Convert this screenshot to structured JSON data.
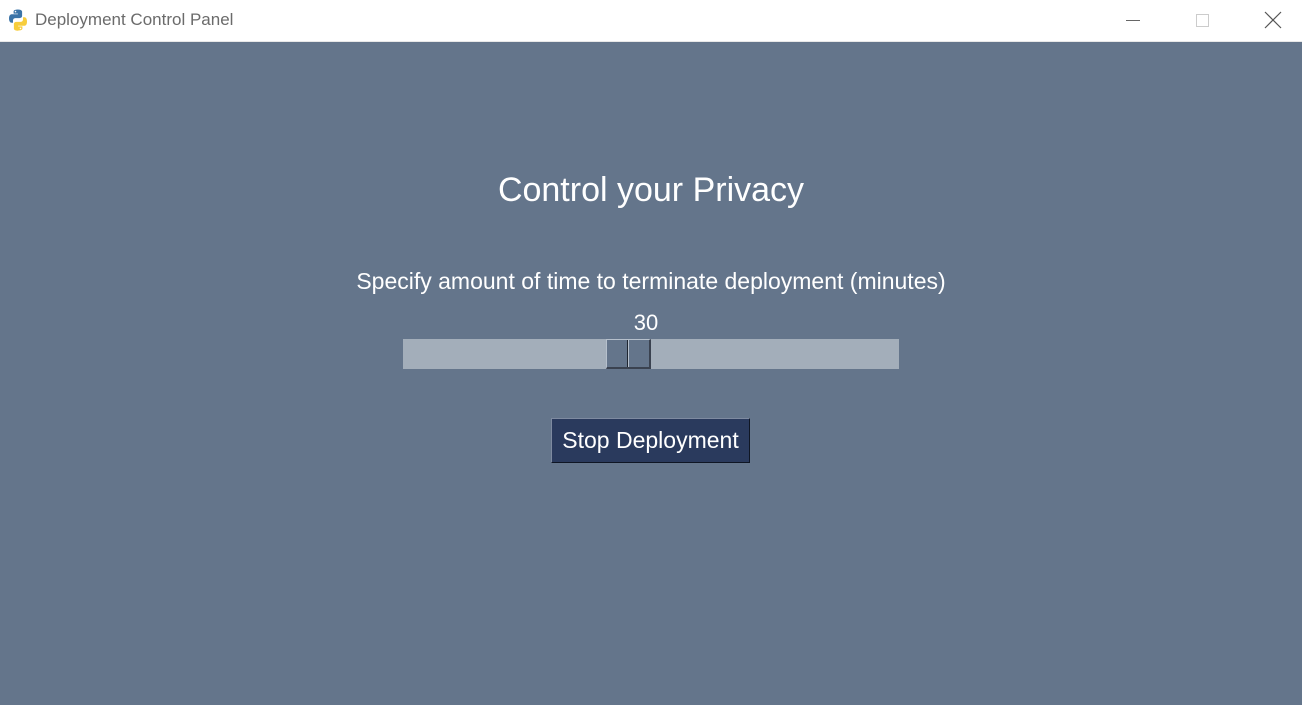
{
  "window": {
    "title": "Deployment Control Panel",
    "controls": {
      "minimize": "minimize-icon",
      "maximize": "maximize-icon",
      "close": "close-icon"
    }
  },
  "main": {
    "heading": "Control your Privacy",
    "prompt": "Specify amount of time to terminate deployment (minutes)",
    "slider": {
      "value": "30",
      "position_fraction": 0.45
    },
    "stop_button_label": "Stop Deployment"
  },
  "colors": {
    "background": "#64758b",
    "slider_track": "#a3aeba",
    "button": "#2a3a5d"
  }
}
